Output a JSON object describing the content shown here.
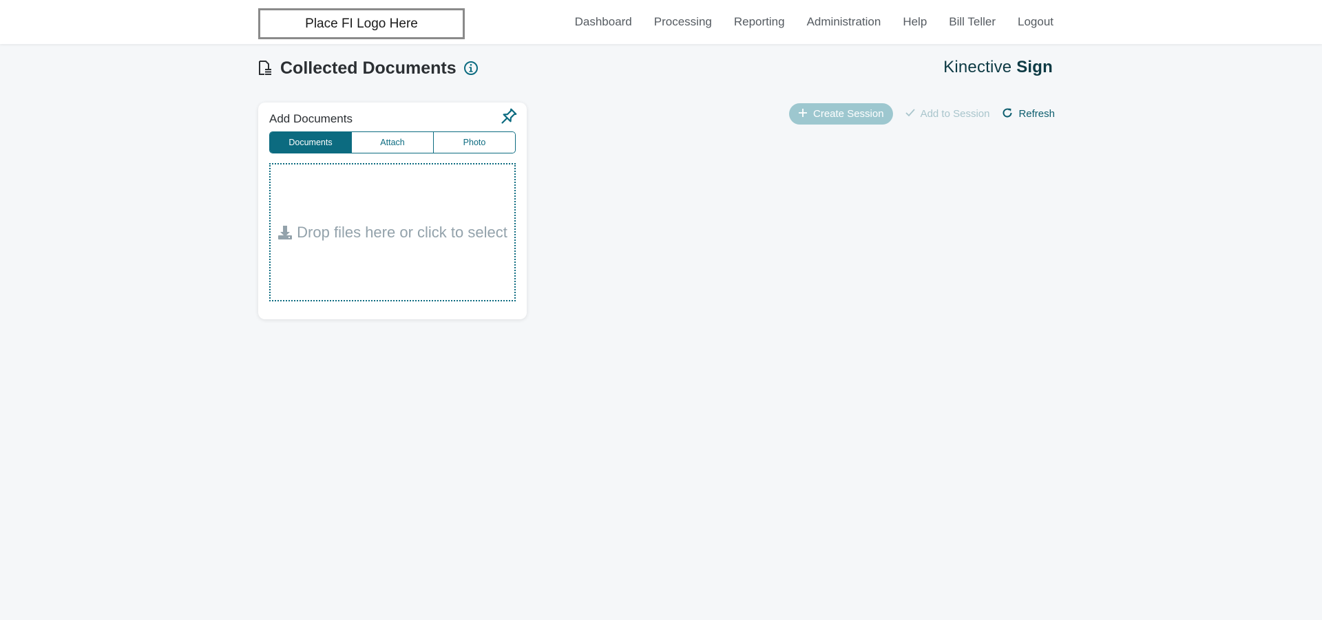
{
  "header": {
    "logo_text": "Place FI Logo Here",
    "nav": [
      "Dashboard",
      "Processing",
      "Reporting",
      "Administration",
      "Help",
      "Bill Teller",
      "Logout"
    ]
  },
  "page": {
    "title": "Collected Documents",
    "brand_light": "Kinective",
    "brand_bold": "Sign"
  },
  "add_documents": {
    "title": "Add Documents",
    "tabs": [
      "Documents",
      "Attach",
      "Photo"
    ],
    "active_tab": "Documents",
    "dropzone_text": "Drop files here or click to select"
  },
  "actions": {
    "create_session": "Create Session",
    "add_to_session": "Add to Session",
    "refresh": "Refresh"
  },
  "colors": {
    "accent": "#0c6b80",
    "background": "#f5f7f9",
    "muted_text": "#93a2ab"
  },
  "icons": {
    "page_title": "document-icon",
    "info": "info-icon",
    "pin": "pin-icon",
    "dropzone": "download-icon",
    "create": "plus-icon",
    "add": "check-icon",
    "refresh": "refresh-icon"
  }
}
